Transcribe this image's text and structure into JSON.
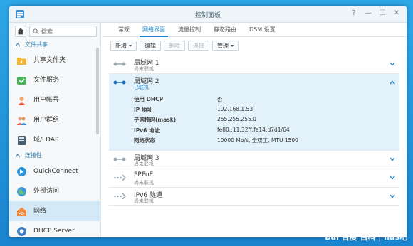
{
  "window": {
    "title": "控制面板"
  },
  "search": {
    "placeholder": "搜索"
  },
  "sidebar": {
    "section_file_sharing": "文件共享",
    "section_connectivity": "连接性",
    "items": [
      {
        "label": "共享文件夹",
        "icon": "shared-folder-icon"
      },
      {
        "label": "文件服务",
        "icon": "file-services-icon"
      },
      {
        "label": "用户帐号",
        "icon": "user-icon"
      },
      {
        "label": "用户群组",
        "icon": "group-icon"
      },
      {
        "label": "域/LDAP",
        "icon": "domain-icon"
      },
      {
        "label": "QuickConnect",
        "icon": "quickconnect-icon"
      },
      {
        "label": "外部访问",
        "icon": "globe-icon"
      },
      {
        "label": "网络",
        "icon": "network-icon"
      },
      {
        "label": "DHCP Server",
        "icon": "dhcp-icon"
      }
    ]
  },
  "tabs": [
    "常规",
    "网络界面",
    "流量控制",
    "静态路由",
    "DSM 设置"
  ],
  "toolbar": {
    "create": "新增",
    "edit": "编辑",
    "delete": "删除",
    "connect": "连接",
    "manage": "管理"
  },
  "interfaces": [
    {
      "name": "局域网 1",
      "status": "尚未联机"
    },
    {
      "name": "局域网 2",
      "status": "已联机"
    },
    {
      "name": "局域网 3",
      "status": "尚未联机"
    },
    {
      "name": "PPPoE",
      "status": "尚未联机"
    },
    {
      "name": "IPv6 隧道",
      "status": "尚未联机"
    }
  ],
  "lan2_details": [
    {
      "key": "使用 DHCP",
      "value": "否"
    },
    {
      "key": "IP 地址",
      "value": "192.168.1.53"
    },
    {
      "key": "子网掩码(mask)",
      "value": "255.255.255.0"
    },
    {
      "key": "IPv6 地址",
      "value": "fe80::11:32ff:fe14:d7d1/64"
    },
    {
      "key": "网络状态",
      "value": "10000 Mb/s, 全双工, MTU 1500"
    }
  ],
  "watermark": "Bai 百度 百科 | nas吧",
  "colors": {
    "accent": "#1f86cc",
    "selected": "#d4e9f7",
    "expanded": "#e3f1fa"
  }
}
